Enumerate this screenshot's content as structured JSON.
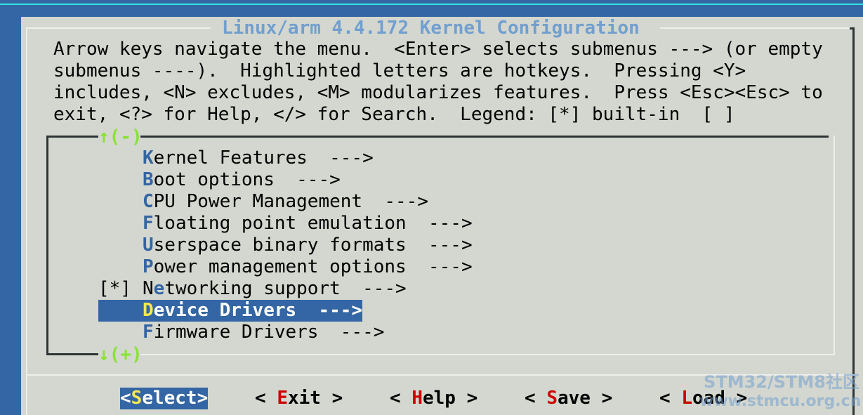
{
  "window": {
    "title": "Linux/arm 4.4.172 Kernel Configuration"
  },
  "help_text": [
    "Arrow keys navigate the menu.  <Enter> selects submenus ---> (or empty",
    "submenus ----).  Highlighted letters are hotkeys.  Pressing <Y>",
    "includes, <N> excludes, <M> modularizes features.  Press <Esc><Esc> to",
    "exit, <?> for Help, </> for Search.  Legend: [*] built-in  [ ]"
  ],
  "menu": {
    "scroll_up": "↑(-)",
    "scroll_down": "↓(+)",
    "items": [
      {
        "prefix": "",
        "hotkey": "K",
        "rest": "ernel Features  --->",
        "selected": false
      },
      {
        "prefix": "",
        "hotkey": "B",
        "rest": "oot options  --->",
        "selected": false
      },
      {
        "prefix": "",
        "hotkey": "C",
        "rest": "PU Power Management  --->",
        "selected": false
      },
      {
        "prefix": "",
        "hotkey": "F",
        "rest": "loating point emulation  --->",
        "selected": false
      },
      {
        "prefix": "",
        "hotkey": "U",
        "rest": "serspace binary formats  --->",
        "selected": false
      },
      {
        "prefix": "",
        "hotkey": "P",
        "rest": "ower management options  --->",
        "selected": false
      },
      {
        "prefix": "[*]",
        "hotkey": "N",
        "hotkey_index": 1,
        "rest": "Networking support  --->",
        "selected": false
      },
      {
        "prefix": "",
        "hotkey": "D",
        "rest": "evice Drivers  --->",
        "selected": true
      },
      {
        "prefix": "",
        "hotkey": "F",
        "rest": "irmware Drivers  --->",
        "selected": false
      }
    ]
  },
  "buttons": [
    {
      "left": "<",
      "hotkey": "S",
      "rest": "elect",
      "right": ">",
      "active": true
    },
    {
      "left": "< ",
      "hotkey": "E",
      "rest": "xit",
      "right": " >",
      "active": false
    },
    {
      "left": "< ",
      "hotkey": "H",
      "rest": "elp",
      "right": " >",
      "active": false
    },
    {
      "left": "< ",
      "hotkey": "S",
      "rest": "ave",
      "right": " >",
      "active": false
    },
    {
      "left": "< ",
      "hotkey": "L",
      "rest": "oad",
      "right": " >",
      "active": false
    }
  ],
  "watermark": {
    "line1": "STM32/STM8社区",
    "line2": "www.stmcu.org.cn"
  },
  "colors": {
    "background": "#3465a4",
    "dialog": "#d3d7cf",
    "title": "#729fcf",
    "hotkey": "#3465a4",
    "selected_bg": "#3465a4",
    "selected_hotkey": "#fce94f",
    "button_hotkey": "#cc0000",
    "scroll_indicator": "#8ae234"
  }
}
